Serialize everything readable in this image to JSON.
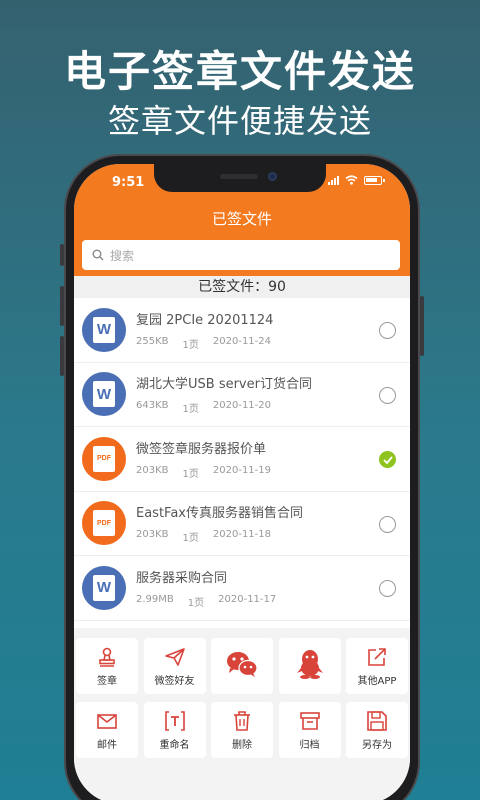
{
  "promo": {
    "title": "电子签章文件发送",
    "subtitle": "签章文件便捷发送"
  },
  "status_bar": {
    "time": "9:51"
  },
  "nav": {
    "title": "已签文件"
  },
  "search": {
    "placeholder": "搜索"
  },
  "summary": {
    "count_text": "已签文件：90"
  },
  "files": [
    {
      "name": "复园 2PCIe 20201124",
      "size": "255KB",
      "pages": "1页",
      "date": "2020-11-24",
      "type": "word",
      "selected": false
    },
    {
      "name": "湖北大学USB server订货合同",
      "size": "643KB",
      "pages": "1页",
      "date": "2020-11-20",
      "type": "word",
      "selected": false
    },
    {
      "name": "微签签章服务器报价单",
      "size": "203KB",
      "pages": "1页",
      "date": "2020-11-19",
      "type": "pdf",
      "selected": true
    },
    {
      "name": "EastFax传真服务器销售合同",
      "size": "203KB",
      "pages": "1页",
      "date": "2020-11-18",
      "type": "pdf",
      "selected": false
    },
    {
      "name": "服务器采购合同",
      "size": "2.99MB",
      "pages": "1页",
      "date": "2020-11-17",
      "type": "word",
      "selected": false
    }
  ],
  "file_icon_text": {
    "word": "W",
    "pdf": "PDF"
  },
  "actions_row1": [
    {
      "label": "签章",
      "icon": "stamp-icon"
    },
    {
      "label": "微签好友",
      "icon": "paper-plane-icon"
    },
    {
      "label": "",
      "icon": "wechat-icon"
    },
    {
      "label": "",
      "icon": "qq-icon"
    },
    {
      "label": "其他APP",
      "icon": "share-icon"
    }
  ],
  "actions_row2": [
    {
      "label": "邮件",
      "icon": "mail-icon"
    },
    {
      "label": "重命名",
      "icon": "rename-icon"
    },
    {
      "label": "删除",
      "icon": "trash-icon"
    },
    {
      "label": "归档",
      "icon": "archive-icon"
    },
    {
      "label": "另存为",
      "icon": "save-icon"
    }
  ],
  "colors": {
    "brand_orange": "#f47a20",
    "word_blue": "#4a6fb5",
    "pdf_orange": "#f26a1b",
    "check_green": "#8fc31f",
    "action_red": "#d9443a"
  }
}
